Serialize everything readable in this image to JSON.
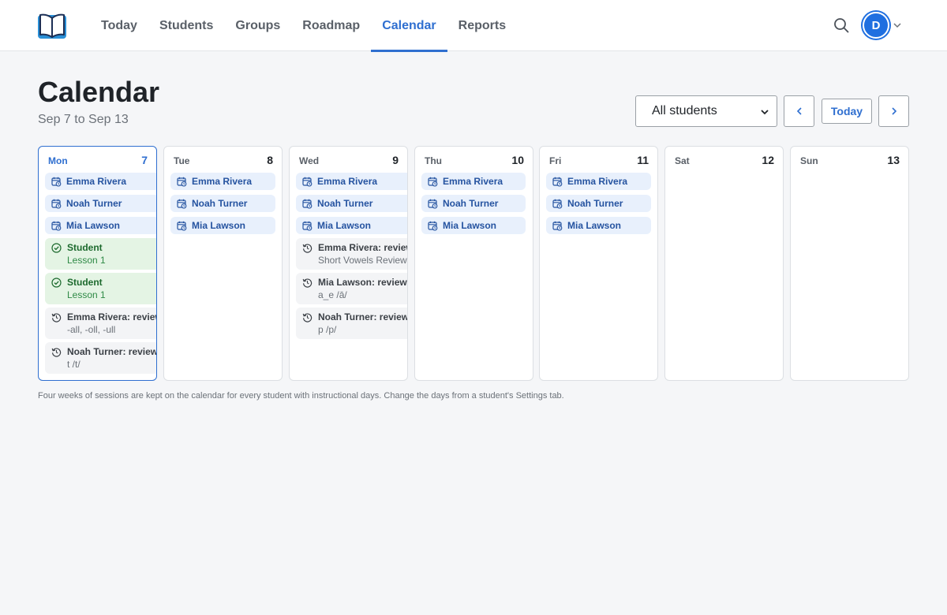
{
  "nav": {
    "items": [
      "Today",
      "Students",
      "Groups",
      "Roadmap",
      "Calendar",
      "Reports"
    ],
    "active_index": 4
  },
  "user": {
    "initial": "D"
  },
  "header": {
    "title": "Calendar",
    "range": "Sep 7 to Sep 13",
    "student_filter": "All students",
    "today_label": "Today"
  },
  "days": [
    {
      "name": "Mon",
      "num": "7",
      "current": true,
      "sessions": [
        "Emma Rivera",
        "Noah Turner",
        "Mia Lawson"
      ],
      "completed": [
        {
          "title": "Student",
          "detail": "Lesson 1"
        },
        {
          "title": "Student",
          "detail": "Lesson 1"
        }
      ],
      "reviews": [
        {
          "title": "Emma Rivera: review",
          "detail": "-all, -oll, -ull"
        },
        {
          "title": "Noah Turner: review",
          "detail": "t /t/"
        }
      ]
    },
    {
      "name": "Tue",
      "num": "8",
      "sessions": [
        "Emma Rivera",
        "Noah Turner",
        "Mia Lawson"
      ]
    },
    {
      "name": "Wed",
      "num": "9",
      "sessions": [
        "Emma Rivera",
        "Noah Turner",
        "Mia Lawson"
      ],
      "reviews": [
        {
          "title": "Emma Rivera: review",
          "detail": "Short Vowels Review (all)"
        },
        {
          "title": "Mia Lawson: review",
          "detail": "a_e /ā/"
        },
        {
          "title": "Noah Turner: review",
          "detail": "p /p/"
        }
      ]
    },
    {
      "name": "Thu",
      "num": "10",
      "sessions": [
        "Emma Rivera",
        "Noah Turner",
        "Mia Lawson"
      ]
    },
    {
      "name": "Fri",
      "num": "11",
      "sessions": [
        "Emma Rivera",
        "Noah Turner",
        "Mia Lawson"
      ]
    },
    {
      "name": "Sat",
      "num": "12"
    },
    {
      "name": "Sun",
      "num": "13"
    }
  ],
  "footnote": "Four weeks of sessions are kept on the calendar for every student with instructional days. Change the days from a student's Settings tab.",
  "colors": {
    "accent": "#2f6fd0",
    "session_bg": "#e8f0fc",
    "completed_bg": "#e4f4e4",
    "review_bg": "#f3f4f6"
  },
  "icons": {
    "session": "calendar-clock-icon",
    "completed": "check-circle-icon",
    "review": "history-icon"
  }
}
